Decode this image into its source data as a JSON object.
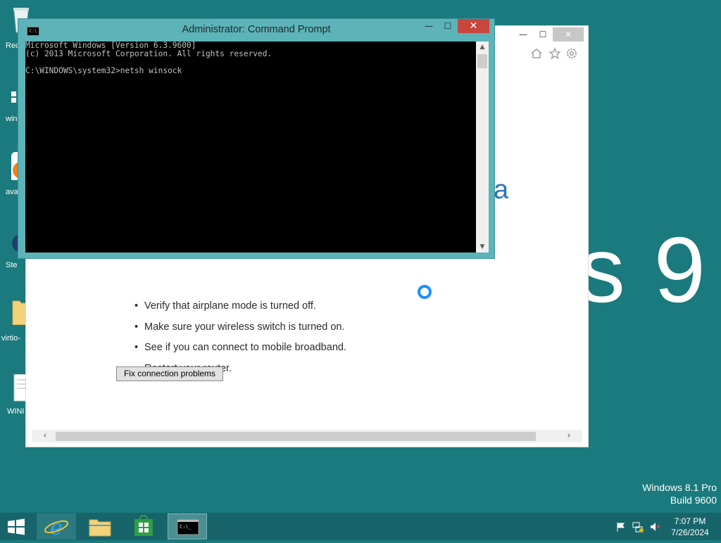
{
  "desktop": {
    "wallpaper_text": "ws 9",
    "watermark": {
      "line1": "Windows 8.1 Pro",
      "line2": "Build 9600"
    },
    "icons": [
      {
        "name": "recycle-bin",
        "label": "Rec"
      },
      {
        "name": "windows-shortcut",
        "label": "wind"
      },
      {
        "name": "avast",
        "label": "avas"
      },
      {
        "name": "steam",
        "label": "Ste"
      },
      {
        "name": "virtio-folder",
        "label": "virtio-"
      },
      {
        "name": "windows-document",
        "label": "WINI"
      }
    ]
  },
  "ie": {
    "partial_heading": "a",
    "tips": [
      "Verify that airplane mode is turned off.",
      "Make sure your wireless switch is turned on.",
      "See if you can connect to mobile broadband.",
      "Restart your router."
    ],
    "fix_button": "Fix connection problems",
    "caption": {
      "minimize": "—",
      "maximize": "☐",
      "close": "✕"
    },
    "toolbar_icons": [
      "home-icon",
      "star-icon",
      "gear-icon"
    ]
  },
  "cmd": {
    "title": "Administrator: Command Prompt",
    "app_icon_text": "C:\\",
    "lines": [
      "Microsoft Windows [Version 6.3.9600]",
      "(c) 2013 Microsoft Corporation. All rights reserved.",
      "",
      "C:\\WINDOWS\\system32>netsh winsock"
    ],
    "caption": {
      "minimize": "—",
      "maximize": "☐",
      "close": "✕"
    }
  },
  "taskbar": {
    "apps": [
      "internet-explorer",
      "file-explorer",
      "store",
      "command-prompt"
    ],
    "active_app": "command-prompt",
    "clock": {
      "time": "7:07 PM",
      "date": "7/26/2024"
    }
  },
  "colors": {
    "desktop_bg": "#1b7a7d",
    "taskbar_bg": "#17656a",
    "cmd_frame": "#5cb3b8",
    "close_red": "#c9463d"
  }
}
